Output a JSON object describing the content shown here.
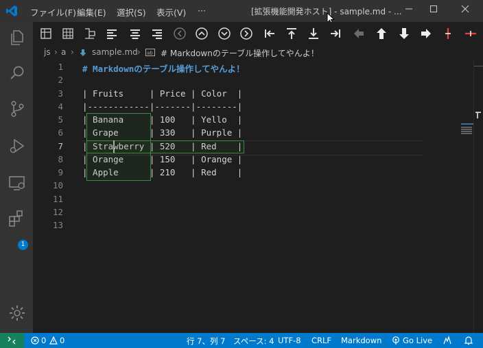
{
  "menu": {
    "items": [
      "ファイル(F)",
      "編集(E)",
      "選択(S)",
      "表示(V)",
      "···"
    ]
  },
  "window": {
    "title": "[拡張機能開発ホスト] - sample.md - ..."
  },
  "breadcrumb": {
    "parts": [
      "js",
      "a",
      "sample.md",
      "# Markdownのテーブル操作してやんよ！"
    ]
  },
  "activity": {
    "extensions_badge": "1"
  },
  "editor": {
    "line_numbers": [
      "1",
      "2",
      "3",
      "4",
      "5",
      "6",
      "7",
      "8",
      "9",
      "10",
      "11",
      "12",
      "13"
    ],
    "active_line": "7",
    "lines": [
      "# Markdownのテーブル操作してやんよ！",
      "",
      "| Fruits     | Price | Color  |",
      "|------------|-------|--------|",
      "| Banana     | 100   | Yello  |",
      "| Grape      | 330   | Purple |",
      "| Strawberry | 520   | Red    |",
      "| Orange     | 150   | Orange |",
      "| Apple      | 210   | Red    |",
      "",
      "",
      "",
      ""
    ]
  },
  "statusbar": {
    "errors": "0",
    "warnings": "0",
    "position": "行 7、列 7",
    "spaces": "スペース: 4",
    "encoding": "UTF-8",
    "eol": "CRLF",
    "language": "Markdown",
    "golive": "Go Live"
  },
  "colors": {
    "statusbar": "#007acc",
    "remote": "#16825d",
    "heading": "#569cd6",
    "selection": "#3c8c3c"
  }
}
